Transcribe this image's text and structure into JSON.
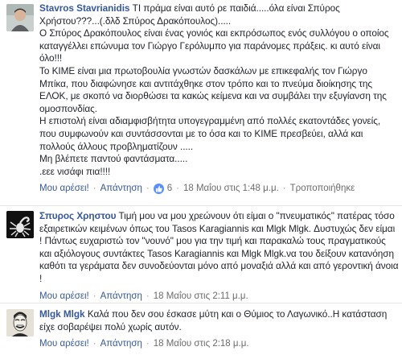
{
  "comments": [
    {
      "author": "Stavros Stavrianidis",
      "lines": [
        "ΤΙ πράμα είναι αυτό ρε παιδιά.....όλα είναι Σπύρος Χρήστου???...(.δλδ Σπύρος Δρακόπουλος).....",
        "Ο Σπύρος Δρακόπουλος είναι ένας γονιός και εκπρόσωπος ενός συλλόγου ο οποίος καταγγέλλει επώνυμα τον Γιώργο Γερόλυμπο για παράνομες πράξεις. κι αυτό είναι όλο!!!",
        "Το ΚΙΜΕ είναι μια πρωτοβουλία γνωστών δασκάλων με επικεφαλής τον Γιώργο Μπίκα, που διαφώνησε και αντιτάχθηκε στον τρόπο και το πνεύμα διοίκησης της ΕΛΟΚ, με σκοπό να διορθώσει τα κακώς κείμενα και να συμβάλει την εξυγίανση της ομοσπονδίας.",
        "Η επιστολή είναι αδιαμφισβήτητα υπογεγραμμένη από πολλές εκατοντάδες γονείς, που συμφωνούν και συντάσσονται με το όσα και το ΚΙΜΕ πρεσβεύει, αλλά και πολλούς άλλους προβληματίζουν .....",
        "Μη βλέπετε παντού φαντάσματα.....",
        ".εεε νισάφι πια!!!!"
      ],
      "like_label": "Μου αρέσει!",
      "reply_label": "Απάντηση",
      "like_count": "6",
      "timestamp": "18 Μαΐου στις 1:48 μ.μ.",
      "edited_label": "Τροποποιήθηκε"
    },
    {
      "author": "Σπυρος Χρηστου",
      "lines": [
        "Τιμή μου να μου χρεώνουν ότι είμαι ο \"πνευματικός\" πατέρας τόσο εξαιρετικών κειμένων όπως του Tasos Karagiannis και Mlgk Mlgk. Δυστυχώς δεν είμαι ! Πάντως ευχαριστώ τον \"νουνό\" μου για την τιμή και παρακαλώ τους πραγματικούς και αξιόλογους συντάκτες Tasos Karagiannis και Mlgk Mlgk.να του δείξουν κατανόηση καθότι τα γεράματα δεν συνοδεύονται μόνο από μοναξιά αλλά και από γεροντική άνοια !"
      ],
      "like_label": "Μου αρέσει!",
      "reply_label": "Απάντηση",
      "timestamp": "18 Μαΐου στις 2:11 μ.μ."
    },
    {
      "author": "Mlgk Mlgk",
      "lines": [
        "Καλά που δεν σου έσκασε μύτη και ο Θύμιος το Λαγωνικό..Η κατάσταση είχε σοβαρέψει πολύ χωρίς αυτόν."
      ],
      "like_label": "Μου αρέσει!",
      "reply_label": "Απάντηση",
      "timestamp": "18 Μαΐου στις 2:18 μ.μ."
    }
  ],
  "colors": {
    "link": "#365899",
    "text": "#1d2129",
    "meta": "#6b6b6b",
    "like_badge": "#5890ff"
  },
  "icons": [
    "avatar-photo",
    "scorpion-avatar",
    "masked-avatar",
    "thumbs-up-icon"
  ]
}
